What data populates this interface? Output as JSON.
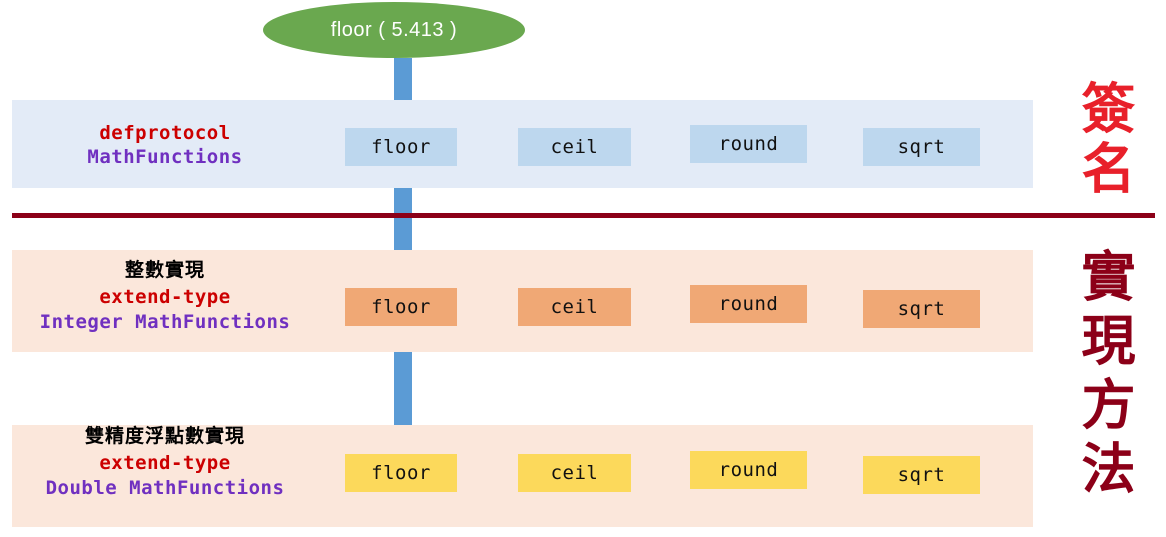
{
  "diagram": {
    "call": {
      "text": "floor ( 5.413 )",
      "fn": "floor",
      "argument": "5.413",
      "color": "#6AA84F"
    },
    "divider_color": "#8C0018",
    "side_captions": [
      {
        "name": "signature",
        "text": "簽名",
        "color": "#E8202A"
      },
      {
        "name": "implementation-method",
        "text": "實現方法",
        "color": "#8C0018"
      }
    ],
    "bands": [
      {
        "id": "signature",
        "zh_title": "",
        "keyword": "defprotocol",
        "type_line": "MathFunctions",
        "band_color": "#E3EBF7",
        "box_color": "#BDD7EE",
        "functions": [
          "floor",
          "ceil",
          "round",
          "sqrt"
        ]
      },
      {
        "id": "integer-impl",
        "zh_title": "整數實現",
        "keyword": "extend-type",
        "type_line": "Integer MathFunctions",
        "band_color": "#FBE7DB",
        "box_color": "#F0A875",
        "functions": [
          "floor",
          "ceil",
          "round",
          "sqrt"
        ]
      },
      {
        "id": "double-impl",
        "zh_title": "雙精度浮點數實現",
        "keyword": "extend-type",
        "type_line": "Double MathFunctions",
        "band_color": "#FBE7DB",
        "box_color": "#FCD95B",
        "functions": [
          "floor",
          "ceil",
          "round",
          "sqrt"
        ]
      }
    ],
    "arrows": {
      "color": "#5B9BD5",
      "dispatch_from": "call-ellipse",
      "dispatch_to": "double-impl.floor"
    }
  }
}
